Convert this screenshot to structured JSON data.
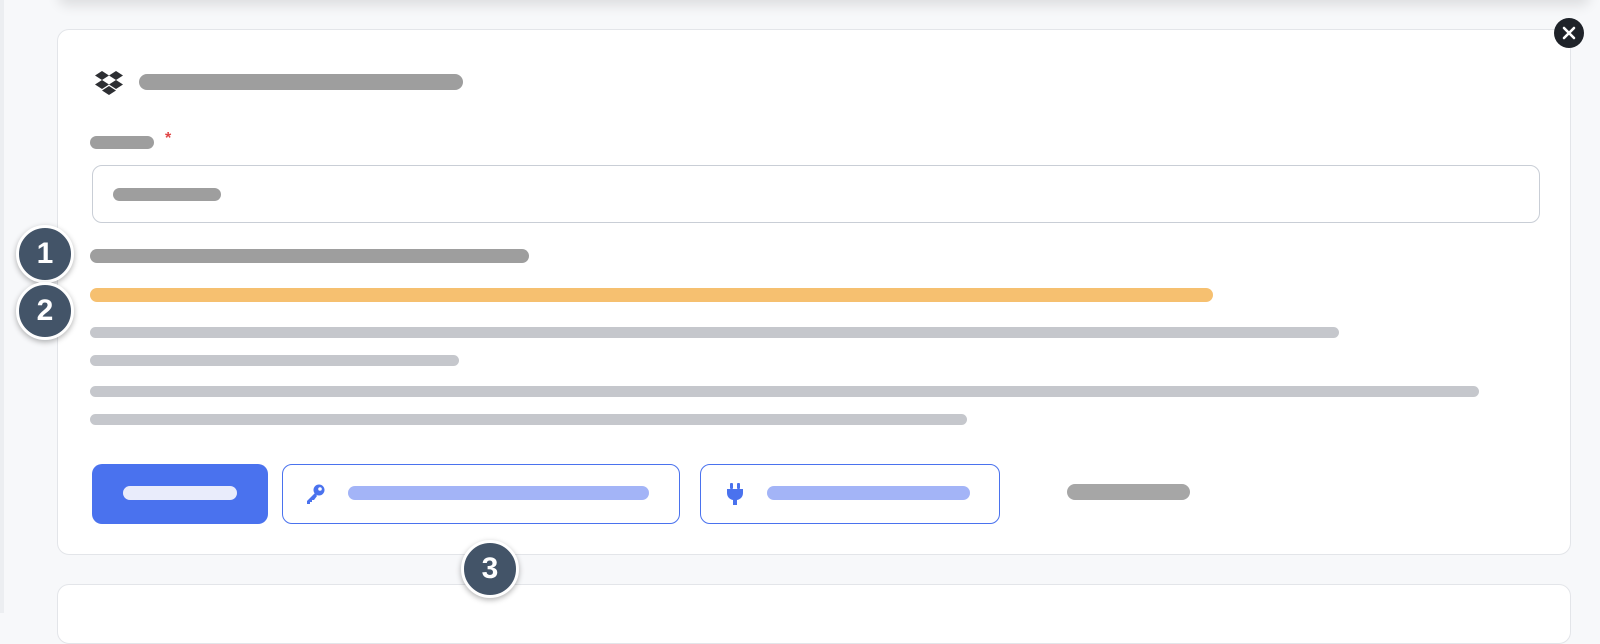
{
  "close_button": {
    "icon": "close-icon"
  },
  "card": {
    "icon": "dropbox-icon",
    "required_mark": "*"
  },
  "actions": {
    "primary_icon": "",
    "key_button_icon": "key-icon",
    "connect_button_icon": "plug-icon"
  },
  "markers": [
    "1",
    "2",
    "3"
  ],
  "colors": {
    "accent": "#4a72ee",
    "accent_light": "#a3b4f7",
    "warning": "#f6c070",
    "placeholder_dark": "#9e9e9e",
    "placeholder_light": "#c5c7cc",
    "marker": "#435468",
    "required": "#e04646"
  }
}
